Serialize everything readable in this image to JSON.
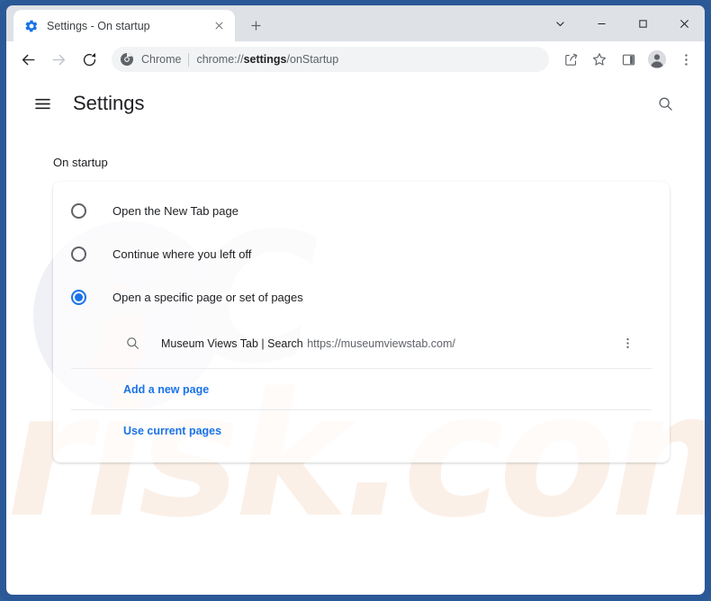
{
  "window": {
    "frame_color": "#2b5896",
    "controls": [
      {
        "name": "tab-search-button",
        "icon": "chevron-down-icon"
      },
      {
        "name": "minimize-button",
        "icon": "minimize-icon"
      },
      {
        "name": "maximize-button",
        "icon": "maximize-icon"
      },
      {
        "name": "close-button",
        "icon": "close-icon"
      }
    ]
  },
  "tab": {
    "favicon": "gear-icon",
    "title": "Settings - On startup",
    "close_icon": "close-icon",
    "new_tab_icon": "plus-icon"
  },
  "toolbar": {
    "back_icon": "arrow-left-icon",
    "forward_icon": "arrow-right-icon",
    "reload_icon": "reload-icon",
    "omnibox": {
      "site_icon": "chrome-logo-icon",
      "chrome_label": "Chrome",
      "url_prefix": "chrome://",
      "url_bold": "settings",
      "url_suffix": "/onStartup",
      "full_url": "chrome://settings/onStartup"
    },
    "actions": [
      {
        "name": "share-icon",
        "label": "Share"
      },
      {
        "name": "star-icon",
        "label": "Bookmark this tab"
      },
      {
        "name": "side-panel-icon",
        "label": "Side panel"
      },
      {
        "name": "profile-avatar-icon",
        "label": "Profile"
      },
      {
        "name": "three-dot-menu-icon",
        "label": "Customize and control Google Chrome"
      }
    ]
  },
  "settings": {
    "hamburger_icon": "hamburger-menu-icon",
    "title": "Settings",
    "search_icon": "search-icon",
    "section_title": "On startup",
    "startup_options": [
      {
        "label": "Open the New Tab page",
        "selected": false
      },
      {
        "label": "Continue where you left off",
        "selected": false
      },
      {
        "label": "Open a specific page or set of pages",
        "selected": true
      }
    ],
    "startup_pages": [
      {
        "icon": "search-icon",
        "title": "Museum Views Tab | Search",
        "url": "https://museumviewstab.com/",
        "menu_icon": "three-dot-menu-icon"
      }
    ],
    "links": [
      {
        "label": "Add a new page"
      },
      {
        "label": "Use current pages"
      }
    ],
    "accent_color": "#1a73e8"
  },
  "watermark": {
    "top_text": "PC",
    "bottom_text": "risk.com"
  }
}
